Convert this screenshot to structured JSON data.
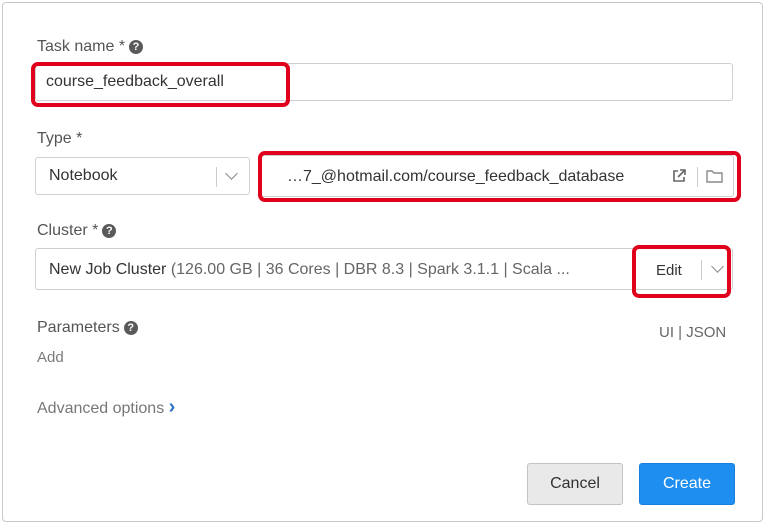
{
  "task_name": {
    "label": "Task name *",
    "value": "course_feedback_overall"
  },
  "type": {
    "label": "Type *",
    "selected": "Notebook",
    "notebook_path": "…7_@hotmail.com/course_feedback_database"
  },
  "cluster": {
    "label": "Cluster *",
    "name": "New Job Cluster",
    "details": " (126.00 GB | 36 Cores | DBR 8.3 | Spark 3.1.1 | Scala ...",
    "edit_label": "Edit"
  },
  "parameters": {
    "label": "Parameters",
    "add_label": "Add",
    "ui_label": "UI",
    "mode_separator": "|",
    "json_label": "JSON"
  },
  "advanced": {
    "label": "Advanced options",
    "chevron": "›"
  },
  "footer": {
    "cancel_label": "Cancel",
    "create_label": "Create"
  },
  "icons": {
    "help": "?",
    "external_link": "external-link-icon",
    "folder": "folder-icon"
  },
  "colors": {
    "highlight": "#e0001b",
    "primary_button": "#1f8ef1",
    "link_blue": "#2a72c8"
  }
}
